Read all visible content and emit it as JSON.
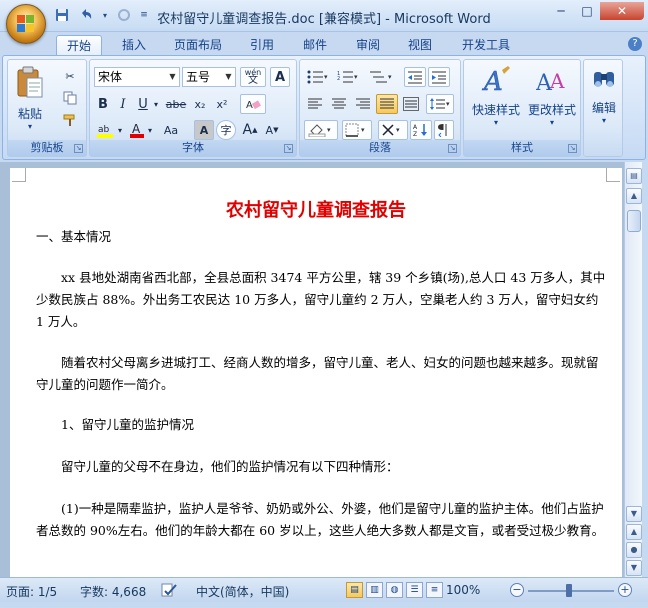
{
  "window": {
    "title": "农村留守儿童调查报告.doc [兼容模式] - Microsoft Word"
  },
  "qat": [
    "save-icon",
    "undo-icon",
    "redo-icon",
    "customize-icon"
  ],
  "tabs": [
    "开始",
    "插入",
    "页面布局",
    "引用",
    "邮件",
    "审阅",
    "视图",
    "开发工具"
  ],
  "ribbon": {
    "clipboard": {
      "label": "剪贴板",
      "paste": "粘贴"
    },
    "font": {
      "label": "字体",
      "font_name": "宋体",
      "font_size": "五号",
      "wen": "wén",
      "bold": "B",
      "italic": "I",
      "underline": "U",
      "strike": "abe",
      "sub": "x₂",
      "sup": "x²",
      "aa": "Aa",
      "grow": "A",
      "shrink": "A"
    },
    "paragraph": {
      "label": "段落"
    },
    "styles": {
      "label": "样式",
      "quick_styles": "快速样式",
      "change_styles": "更改样式"
    },
    "editing": {
      "label": "编辑",
      "edit": "编辑"
    }
  },
  "document": {
    "title": "农村留守儿童调查报告",
    "paragraphs": [
      "一、基本情况",
      "xx 县地处湖南省西北部，全县总面积 3474 平方公里，辖 39 个乡镇(场),总人口 43 万多人，其中少数民族占 88%。外出务工农民达 10 万多人，留守儿童约 2 万人，空巢老人约 3 万人，留守妇女约 1 万人。",
      "随着农村父母离乡进城打工、经商人数的增多，留守儿童、老人、妇女的问题也越来越多。现就留守儿童的问题作一简介。",
      "1、留守儿童的监护情况",
      "留守儿童的父母不在身边，他们的监护情况有以下四种情形：",
      "(1)一种是隔辈监护，监护人是爷爷、奶奶或外公、外婆，他们是留守儿童的监护主体。他们占监护者总数的 90%左右。他们的年龄大都在 60 岁以上，这些人绝大多数人都是文盲，或者受过极少教育。"
    ]
  },
  "status": {
    "page": "页面: 1/5",
    "words": "字数: 4,668",
    "language": "中文(简体，中国)",
    "zoom": "100%"
  },
  "colors": {
    "title_red": "#e00000",
    "accent": "#15428b"
  }
}
